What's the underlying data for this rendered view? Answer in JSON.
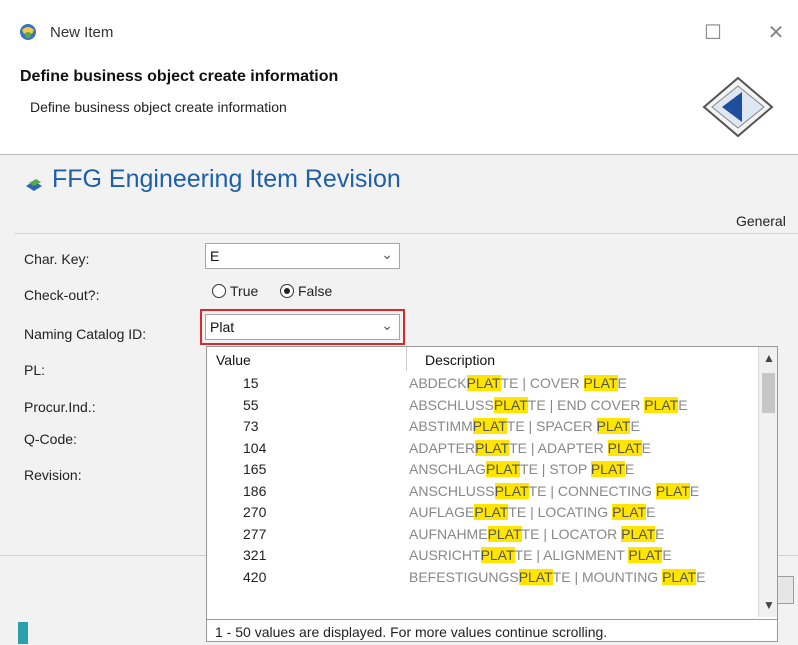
{
  "window": {
    "title": "New Item"
  },
  "header": {
    "title": "Define business object create information",
    "subtitle": "Define business object create information"
  },
  "object_type": {
    "title": "FFG Engineering Item Revision"
  },
  "tab": {
    "label": "General"
  },
  "form": {
    "char_key": {
      "label": "Char. Key:",
      "value": "E"
    },
    "checkout": {
      "label": "Check-out?:",
      "option_true": "True",
      "option_false": "False",
      "selected": "False"
    },
    "naming_catalog": {
      "label": "Naming Catalog ID:",
      "value": "Plat"
    },
    "pl": {
      "label": "PL:"
    },
    "procur": {
      "label": "Procur.Ind.:"
    },
    "qcode": {
      "label": "Q-Code:"
    },
    "revision": {
      "label": "Revision:"
    }
  },
  "dropdown": {
    "col_value": "Value",
    "col_description": "Description",
    "highlight": "PLAT",
    "rows": [
      {
        "value": "15",
        "desc": [
          "ABDECK",
          "PLAT",
          "TE | COVER ",
          "PLAT",
          "E"
        ]
      },
      {
        "value": "55",
        "desc": [
          "ABSCHLUSS",
          "PLAT",
          "TE | END COVER ",
          "PLAT",
          "E"
        ]
      },
      {
        "value": "73",
        "desc": [
          "ABSTIMM",
          "PLAT",
          "TE | SPACER ",
          "PLAT",
          "E"
        ]
      },
      {
        "value": "104",
        "desc": [
          "ADAPTER",
          "PLAT",
          "TE | ADAPTER ",
          "PLAT",
          "E"
        ]
      },
      {
        "value": "165",
        "desc": [
          "ANSCHLAG",
          "PLAT",
          "TE | STOP ",
          "PLAT",
          "E"
        ]
      },
      {
        "value": "186",
        "desc": [
          "ANSCHLUSS",
          "PLAT",
          "TE | CONNECTING ",
          "PLAT",
          "E"
        ]
      },
      {
        "value": "270",
        "desc": [
          "AUFLAGE",
          "PLAT",
          "TE | LOCATING ",
          "PLAT",
          "E"
        ]
      },
      {
        "value": "277",
        "desc": [
          "AUFNAHME",
          "PLAT",
          "TE | LOCATOR ",
          "PLAT",
          "E"
        ]
      },
      {
        "value": "321",
        "desc": [
          "AUSRICHT",
          "PLAT",
          "TE | ALIGNMENT ",
          "PLAT",
          "E"
        ]
      },
      {
        "value": "420",
        "desc": [
          "BEFESTIGUNGS",
          "PLAT",
          "TE | MOUNTING ",
          "PLAT",
          "E"
        ]
      }
    ],
    "footer": "1 - 50 values are displayed. For more values continue scrolling."
  },
  "colors": {
    "accent_blue": "#1e5fa8",
    "highlight_yellow": "#ffe500",
    "focus_red": "#d9292b"
  }
}
